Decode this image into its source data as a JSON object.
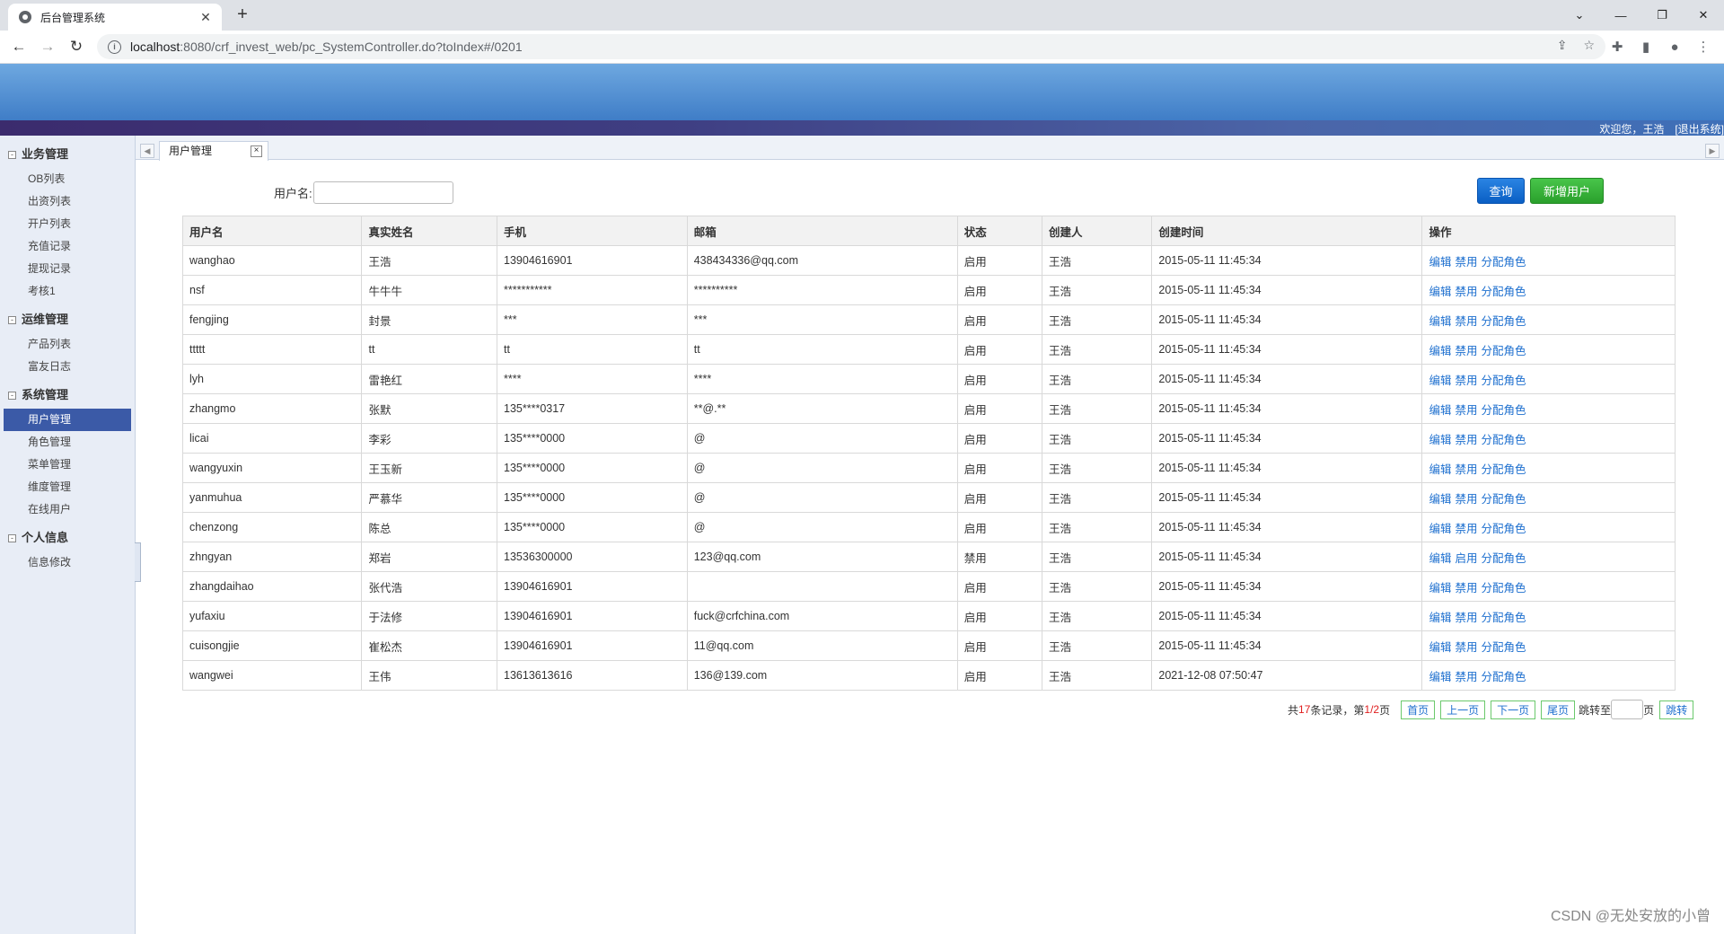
{
  "browser": {
    "tab_title": "后台管理系统",
    "url_host": "localhost",
    "url_rest": ":8080/crf_invest_web/pc_SystemController.do?toIndex#/0201"
  },
  "header": {
    "welcome": "欢迎您，王浩　[退出系统]"
  },
  "sidebar": {
    "groups": [
      {
        "title": "业务管理",
        "items": [
          "OB列表",
          "出资列表",
          "开户列表",
          "充值记录",
          "提现记录",
          "考核1"
        ]
      },
      {
        "title": "运维管理",
        "items": [
          "产品列表",
          "富友日志"
        ]
      },
      {
        "title": "系统管理",
        "items": [
          "用户管理",
          "角色管理",
          "菜单管理",
          "维度管理",
          "在线用户"
        ]
      },
      {
        "title": "个人信息",
        "items": [
          "信息修改"
        ]
      }
    ]
  },
  "tabs": {
    "active": "用户管理"
  },
  "search": {
    "label": "用户名:",
    "value": ""
  },
  "buttons": {
    "query": "查询",
    "add_user": "新增用户"
  },
  "table": {
    "headers": [
      "用户名",
      "真实姓名",
      "手机",
      "邮箱",
      "状态",
      "创建人",
      "创建时间",
      "操作"
    ],
    "rows": [
      [
        "wanghao",
        "王浩",
        "13904616901",
        "438434336@qq.com",
        "启用",
        "王浩",
        "2015-05-11 11:45:34",
        "编辑",
        "禁用",
        "分配角色"
      ],
      [
        "nsf",
        "牛牛牛",
        "***********",
        "**********",
        "启用",
        "王浩",
        "2015-05-11 11:45:34",
        "编辑",
        "禁用",
        "分配角色"
      ],
      [
        "fengjing",
        "封景",
        "***",
        "***",
        "启用",
        "王浩",
        "2015-05-11 11:45:34",
        "编辑",
        "禁用",
        "分配角色"
      ],
      [
        "ttttt",
        "tt",
        "tt",
        "tt",
        "启用",
        "王浩",
        "2015-05-11 11:45:34",
        "编辑",
        "禁用",
        "分配角色"
      ],
      [
        "lyh",
        "雷艳红",
        "****",
        "****",
        "启用",
        "王浩",
        "2015-05-11 11:45:34",
        "编辑",
        "禁用",
        "分配角色"
      ],
      [
        "zhangmo",
        "张默",
        "135****0317",
        "**@.**",
        "启用",
        "王浩",
        "2015-05-11 11:45:34",
        "编辑",
        "禁用",
        "分配角色"
      ],
      [
        "licai",
        "李彩",
        "135****0000",
        "@",
        "启用",
        "王浩",
        "2015-05-11 11:45:34",
        "编辑",
        "禁用",
        "分配角色"
      ],
      [
        "wangyuxin",
        "王玉新",
        "135****0000",
        "@",
        "启用",
        "王浩",
        "2015-05-11 11:45:34",
        "编辑",
        "禁用",
        "分配角色"
      ],
      [
        "yanmuhua",
        "严慕华",
        "135****0000",
        "@",
        "启用",
        "王浩",
        "2015-05-11 11:45:34",
        "编辑",
        "禁用",
        "分配角色"
      ],
      [
        "chenzong",
        "陈总",
        "135****0000",
        "@",
        "启用",
        "王浩",
        "2015-05-11 11:45:34",
        "编辑",
        "禁用",
        "分配角色"
      ],
      [
        "zhngyan",
        "郑岩",
        "13536300000",
        "123@qq.com",
        "禁用",
        "王浩",
        "2015-05-11 11:45:34",
        "编辑",
        "启用",
        "分配角色"
      ],
      [
        "zhangdaihao",
        "张代浩",
        "13904616901",
        "",
        "启用",
        "王浩",
        "2015-05-11 11:45:34",
        "编辑",
        "禁用",
        "分配角色"
      ],
      [
        "yufaxiu",
        "于法修",
        "13904616901",
        "fuck@crfchina.com",
        "启用",
        "王浩",
        "2015-05-11 11:45:34",
        "编辑",
        "禁用",
        "分配角色"
      ],
      [
        "cuisongjie",
        "崔松杰",
        "13904616901",
        "11@qq.com",
        "启用",
        "王浩",
        "2015-05-11 11:45:34",
        "编辑",
        "禁用",
        "分配角色"
      ],
      [
        "wangwei",
        "王伟",
        "13613613616",
        "136@139.com",
        "启用",
        "王浩",
        "2021-12-08 07:50:47",
        "编辑",
        "禁用",
        "分配角色"
      ]
    ]
  },
  "pager": {
    "prefix": "共",
    "total": "17",
    "mid": "条记录，第",
    "page": "1/2",
    "suffix": "页",
    "first": "首页",
    "prev": "上一页",
    "next": "下一页",
    "last": "尾页",
    "jump_label": "跳转至",
    "page_unit": "页",
    "jump_btn": "跳转"
  },
  "watermark": "CSDN @无处安放的小曾"
}
